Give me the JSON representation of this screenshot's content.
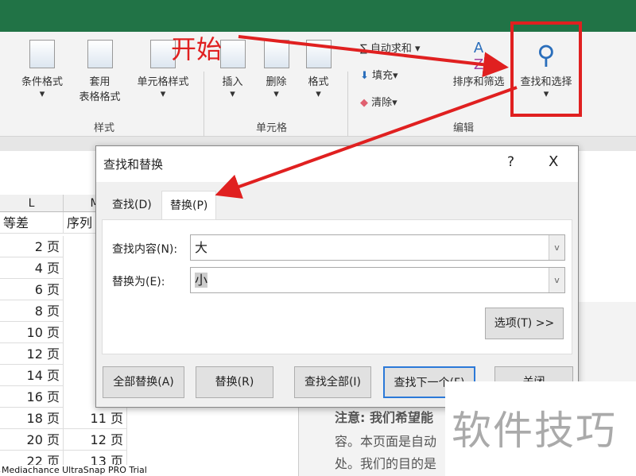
{
  "ribbon": {
    "styles": {
      "cond_format": "条件格式",
      "table_format_1": "套用",
      "table_format_2": "表格格式",
      "cell_style": "单元格样式",
      "group": "样式"
    },
    "cells": {
      "insert": "插入",
      "delete": "删除",
      "format": "格式",
      "group": "单元格"
    },
    "editing": {
      "autosum": "自动求和",
      "fill": "填充",
      "clear": "清除",
      "sort_filter": "排序和筛选",
      "find_select": "查找和选择",
      "group": "编辑"
    }
  },
  "annotation": {
    "start_label": "开始",
    "color": "#e02020"
  },
  "sheet": {
    "columns": [
      "L",
      "M"
    ],
    "header": [
      "等差",
      "序列"
    ],
    "col_l": [
      "2 页",
      "4 页",
      "6 页",
      "8 页",
      "10 页",
      "12 页",
      "14 页",
      "16 页",
      "18 页",
      "20 页",
      "22 页"
    ],
    "col_m": [
      "11 页",
      "12 页",
      "13 页"
    ]
  },
  "side_text": [
    "注意: 我们希望能",
    "容。本页面是自动",
    "处。我们的目的是"
  ],
  "dialog": {
    "title": "查找和替换",
    "help": "?",
    "close": "X",
    "tabs": [
      "查找(D)",
      "替换(P)"
    ],
    "find_label": "查找内容(N):",
    "find_value": "大",
    "replace_label": "替换为(E):",
    "replace_value": "小",
    "options": "选项(T) >>",
    "buttons": {
      "replace_all": "全部替换(A)",
      "replace": "替换(R)",
      "find_all": "查找全部(I)",
      "find_next": "查找下一个(F)",
      "close": "关闭"
    }
  },
  "watermark": "软件技巧",
  "trial": "Mediachance UltraSnap PRO Trial"
}
